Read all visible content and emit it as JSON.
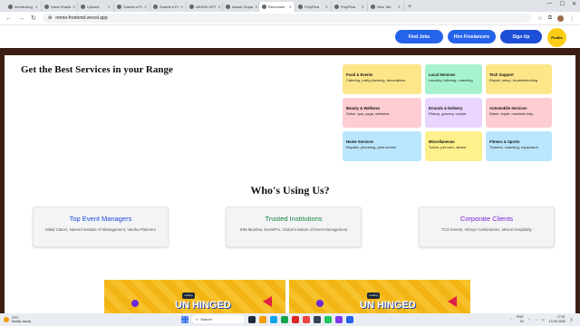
{
  "browser": {
    "tabs": [
      {
        "label": "Introducing"
      },
      {
        "label": "Umar Khalid"
      },
      {
        "label": "Upwork"
      },
      {
        "label": "Submit a Pr"
      },
      {
        "label": "Submit a Pr"
      },
      {
        "label": "AKASH-SPT"
      },
      {
        "label": "Akash Gupta"
      },
      {
        "label": "Renovator"
      },
      {
        "label": "PolyFlixa"
      },
      {
        "label": "PolyFlixa"
      },
      {
        "label": "New Tab"
      }
    ],
    "url": "renno-frontend.vercel.app"
  },
  "header": {
    "find_jobs": "Find Jobs",
    "hire_freelancers": "Hire Freelancers",
    "sign_up": "Sign Up",
    "profile": "Profile"
  },
  "hero": {
    "title": "Get the Best Services in your Range"
  },
  "categories": [
    {
      "title": "Food & Events",
      "desc": "Catering, party planning, decorations",
      "color": "#fde68a"
    },
    {
      "title": "Local Services",
      "desc": "Laundry, tailoring, coaching",
      "color": "#a7f3d0"
    },
    {
      "title": "Tech Support",
      "desc": "Repair, setup, troubleshooting",
      "color": "#fde68a"
    },
    {
      "title": "Beauty & Wellness",
      "desc": "Salon, spa, yoga, wellness",
      "color": "#fecdd3"
    },
    {
      "title": "Errands & Delivery",
      "desc": "Pickup, grocery, courier",
      "color": "#e9d5ff"
    },
    {
      "title": "Automobile Services",
      "desc": "Wash, repair, roadside help",
      "color": "#fecdd3"
    },
    {
      "title": "Home Services",
      "desc": "Repairs, plumbing, pest control",
      "color": "#bae6fd"
    },
    {
      "title": "Miscellaneous",
      "desc": "Tutors, pet care, others",
      "color": "#fef08a"
    },
    {
      "title": "Fitness & Sports",
      "desc": "Trainers, coaching, equipment",
      "color": "#bae6fd"
    }
  ],
  "who": {
    "title": "Who's Using Us?",
    "cards": [
      {
        "title": "Top Event Managers",
        "desc": "Mittal Caters, Naemd Institute of Management, Varsha Planners",
        "color": "#1d4ed8"
      },
      {
        "title": "Trusted Institutions",
        "desc": "IHM Mumbai, EventPro, Global Institute of Event Management",
        "color": "#15803d"
      },
      {
        "title": "Corporate Clients",
        "desc": "TCS Events, Infosys Celebrations, Maruti Hospitality",
        "color": "#7e22ce"
      }
    ]
  },
  "banners": [
    {
      "logo": "unstop",
      "text": "UN HINGED"
    },
    {
      "logo": "unstop",
      "text": "UN HINGED"
    }
  ],
  "taskbar": {
    "temp": "29°C",
    "weather": "Mostly cloudy",
    "search": "Search",
    "lang": "ENG",
    "region": "IN",
    "time": "17:51",
    "date": "13-09-2025"
  }
}
